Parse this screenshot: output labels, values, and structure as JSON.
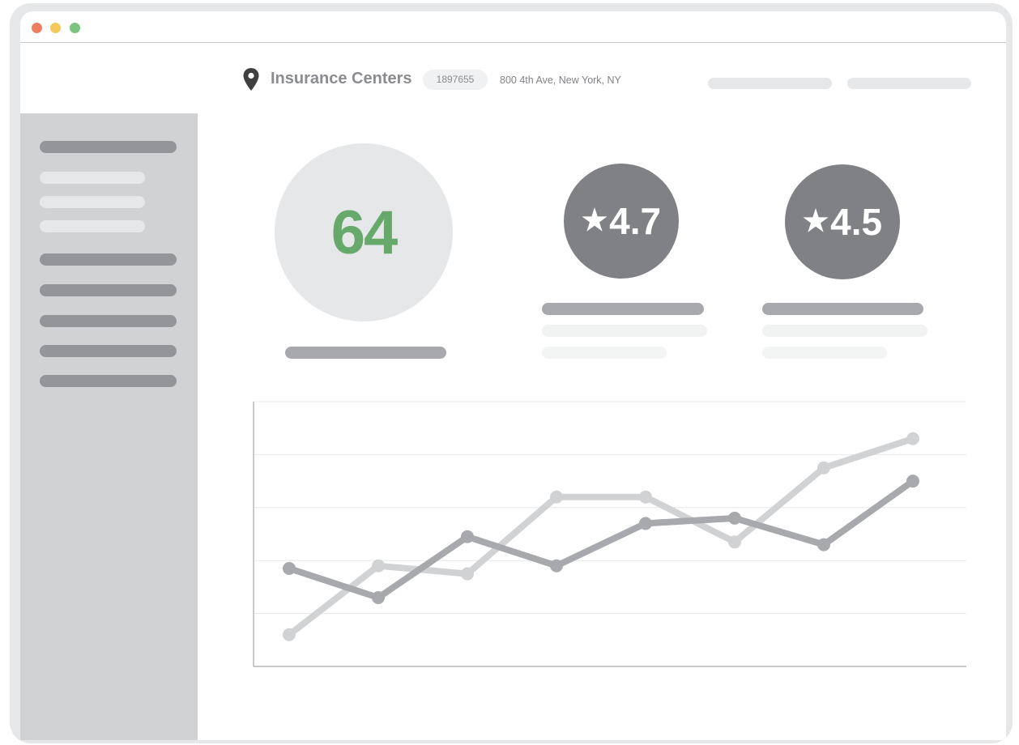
{
  "window": {
    "controls": [
      "close",
      "minimize",
      "maximize"
    ],
    "colors": {
      "close": "#ee7d62",
      "minimize": "#f3c75a",
      "maximize": "#7bc47f"
    }
  },
  "header": {
    "icon": "map-pin-icon",
    "title": "Insurance Centers",
    "id_badge": "1897655",
    "address": "800 4th Ave, New York, NY"
  },
  "metrics": {
    "score": {
      "value": "64",
      "color": "#66a96a"
    },
    "ratings": [
      {
        "star": "★",
        "value": "4.7"
      },
      {
        "star": "★",
        "value": "4.5"
      }
    ]
  },
  "chart_data": {
    "type": "line",
    "x": [
      1,
      2,
      3,
      4,
      5,
      6,
      7,
      8,
      9
    ],
    "series": [
      {
        "color": "#d1d2d4",
        "points": [
          [
            1,
            12
          ],
          [
            2,
            38
          ],
          [
            3,
            35
          ],
          [
            4,
            64
          ],
          [
            5,
            64
          ],
          [
            6,
            47
          ],
          [
            7,
            75
          ],
          [
            8,
            86
          ]
        ]
      },
      {
        "color": "#a7a9ac",
        "points": [
          [
            1,
            37
          ],
          [
            2,
            26
          ],
          [
            3,
            49
          ],
          [
            4,
            38
          ],
          [
            5,
            54
          ],
          [
            6,
            56
          ],
          [
            7,
            46
          ],
          [
            8,
            70
          ]
        ]
      }
    ],
    "grid": true,
    "title": "",
    "xlabel": "",
    "ylabel": "",
    "ylim": [
      0,
      100
    ]
  }
}
